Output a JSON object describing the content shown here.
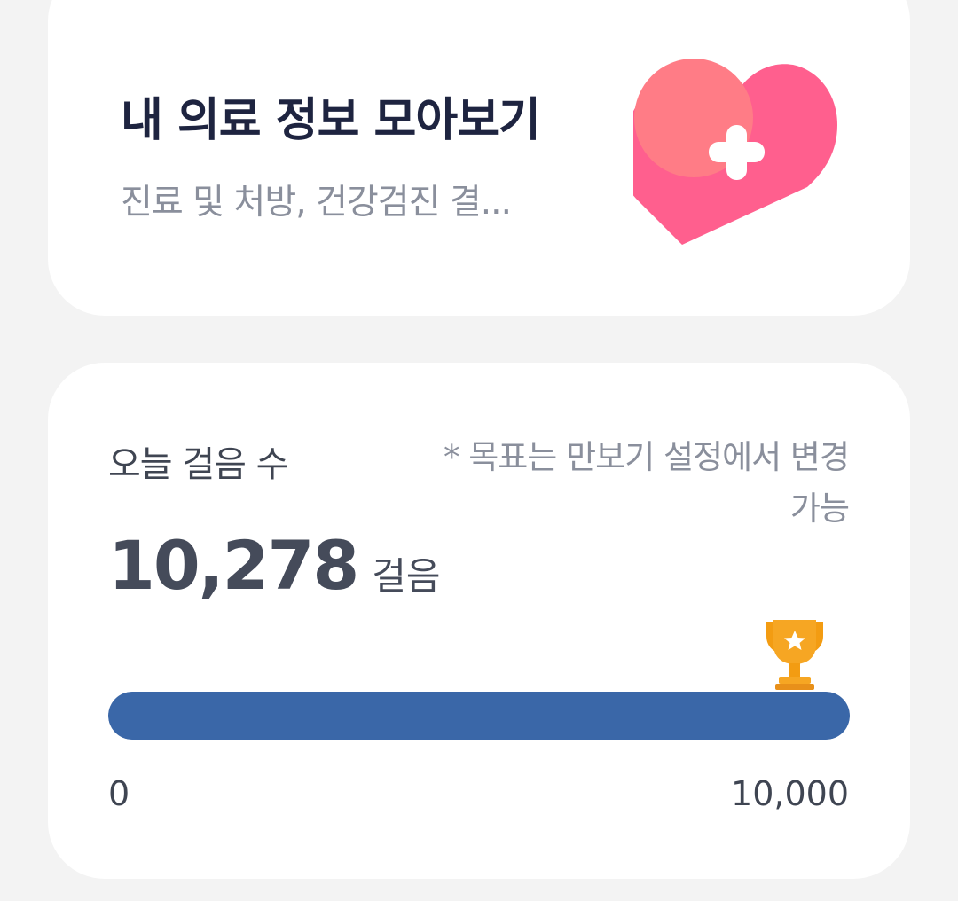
{
  "medical_card": {
    "title": "내 의료 정보 모아보기",
    "subtitle": "진료 및 처방, 건강검진 결...",
    "icon": "heart-plus-icon",
    "icon_colors": {
      "heart": "#ff5f8e",
      "circle": "#ff7c86",
      "cross": "#ffffff"
    }
  },
  "steps_card": {
    "label": "오늘 걸음 수",
    "goal_note": "* 목표는 만보기 설정에서 변경가능",
    "steps_value": "10,278",
    "steps_unit": "걸음",
    "progress": 1.0,
    "axis_min": "0",
    "axis_max": "10,000",
    "icon": "trophy-icon",
    "colors": {
      "bar": "#3a67a8",
      "trophy": "#f6a623"
    }
  }
}
